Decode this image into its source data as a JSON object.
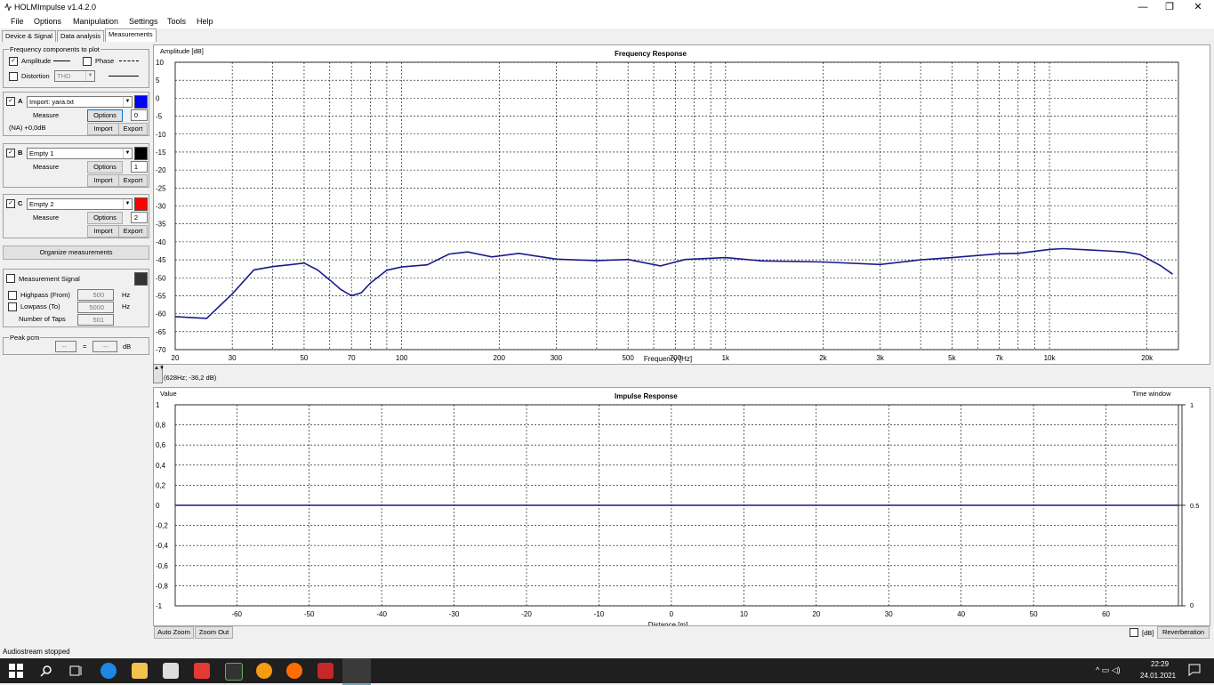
{
  "window": {
    "title": "HOLMImpulse  v1.4.2.0",
    "minimize": "—",
    "maximize": "❐",
    "close": "✕"
  },
  "menu": [
    "File",
    "Options",
    "Manipulation",
    "Settings",
    "Tools",
    "Help"
  ],
  "tabs": [
    "Device & Signal",
    "Data analysis",
    "Measurements"
  ],
  "freq_components": {
    "legend": "Frequency components to plot",
    "amplitude": {
      "label": "Amplitude",
      "checked": true
    },
    "phase": {
      "label": "Phase",
      "checked": false
    },
    "distortion": {
      "label": "Distortion",
      "checked": false,
      "value": "THD"
    }
  },
  "channels": [
    {
      "letter": "A",
      "checked": true,
      "name": "Import: yara.txt",
      "color": "#0000ff",
      "measure": "Measure",
      "options": "Options",
      "num": "0",
      "info": "(NA) +0,0dB",
      "import": "Import",
      "export": "Export"
    },
    {
      "letter": "B",
      "checked": true,
      "name": "Empty 1",
      "color": "#000000",
      "measure": "Measure",
      "options": "Options",
      "num": "1",
      "info": "",
      "import": "Import",
      "export": "Export"
    },
    {
      "letter": "C",
      "checked": true,
      "name": "Empty 2",
      "color": "#ff0000",
      "measure": "Measure",
      "options": "Options",
      "num": "2",
      "info": "",
      "import": "Import",
      "export": "Export"
    }
  ],
  "organize": "Organize measurements",
  "signal": {
    "measurement_signal": "Measurement Signal",
    "highpass": "Highpass (From)",
    "highpass_val": "500",
    "hz1": "Hz",
    "lowpass": "Lowpass (To)",
    "lowpass_val": "5000",
    "hz2": "Hz",
    "taps": "Number of Taps",
    "taps_val": "501"
  },
  "peak": {
    "legend": "Peak pcm",
    "v1": "--",
    "eq": "=",
    "v2": "--",
    "unit": "dB"
  },
  "freq_chart": {
    "title": "Frequency Response",
    "ylabel": "Amplitude [dB]",
    "xlabel": "Frequency [Hz]",
    "cursor": "(628Hz; -36,2 dB)",
    "scroll_icon": "▲▼"
  },
  "imp_chart": {
    "title": "Impulse Response",
    "ylabel": "Value",
    "xlabel": "Distance [m]",
    "time_window": "Time window",
    "tw_top": "1",
    "tw_mid": "0.5",
    "tw_bot": "0",
    "auto_zoom": "Auto Zoom",
    "zoom_out": "Zoom Out",
    "db_label": "[dB]",
    "reverberation": "Reverberation"
  },
  "status": "Audiostream stopped",
  "taskbar": {
    "time": "22:29",
    "date": "24.01.2021",
    "tray": "^ ▭ ◁)"
  },
  "chart_data": [
    {
      "type": "line",
      "title": "Frequency Response",
      "xlabel": "Frequency [Hz]",
      "ylabel": "Amplitude [dB]",
      "xscale": "log",
      "xlim": [
        20,
        25000
      ],
      "ylim": [
        -70,
        10
      ],
      "yticks": [
        10,
        5,
        0,
        -5,
        -10,
        -15,
        -20,
        -25,
        -30,
        -35,
        -40,
        -45,
        -50,
        -55,
        -60,
        -65,
        -70
      ],
      "xticks": [
        20,
        30,
        50,
        70,
        100,
        200,
        300,
        500,
        700,
        1000,
        2000,
        3000,
        5000,
        7000,
        10000,
        20000
      ],
      "xticklabels": [
        "20",
        "30",
        "50",
        "70",
        "100",
        "200",
        "300",
        "500",
        "700",
        "1k",
        "2k",
        "3k",
        "5k",
        "7k",
        "10k",
        "20k"
      ],
      "grid": true,
      "series": [
        {
          "color": "#1a1a8c",
          "x": [
            20,
            25,
            30,
            35,
            40,
            45,
            50,
            55,
            60,
            65,
            70,
            75,
            80,
            90,
            100,
            120,
            140,
            160,
            190,
            230,
            300,
            400,
            500,
            630,
            750,
            1000,
            1300,
            2000,
            3000,
            4000,
            5000,
            6000,
            7000,
            8000,
            9000,
            10000,
            11000,
            13000,
            15000,
            17000,
            19000,
            22000,
            24000
          ],
          "y": [
            -60.8,
            -61.3,
            -54.5,
            -47.8,
            -46.9,
            -46.4,
            -45.9,
            -47.8,
            -50.6,
            -53.3,
            -55.0,
            -54.2,
            -51.5,
            -47.9,
            -47.0,
            -46.4,
            -43.4,
            -42.8,
            -44.2,
            -43.2,
            -44.8,
            -45.2,
            -44.9,
            -46.7,
            -44.9,
            -44.4,
            -45.3,
            -45.6,
            -46.3,
            -45.0,
            -44.4,
            -43.8,
            -43.3,
            -43.2,
            -42.6,
            -42.1,
            -41.9,
            -42.2,
            -42.5,
            -42.8,
            -43.5,
            -46.6,
            -49.0
          ]
        }
      ]
    },
    {
      "type": "line",
      "title": "Impulse Response",
      "xlabel": "Distance [m]",
      "ylabel": "Value",
      "xlim": [
        -68.5,
        70
      ],
      "ylim": [
        -1,
        1
      ],
      "xticks": [
        -60,
        -50,
        -40,
        -30,
        -20,
        -10,
        0,
        10,
        20,
        30,
        40,
        50,
        60
      ],
      "yticks": [
        1,
        0.8,
        0.6,
        0.4,
        0.2,
        0,
        -0.2,
        -0.4,
        -0.6,
        -0.8,
        -1
      ],
      "yticklabels": [
        "1",
        "0,8",
        "0,6",
        "0,4",
        "0,2",
        "0",
        "-0,2",
        "-0,4",
        "-0,6",
        "-0,8",
        "-1"
      ],
      "grid": true,
      "series": [
        {
          "color": "#1a1a8c",
          "x": [
            -68.5,
            70
          ],
          "y": [
            0,
            0
          ]
        }
      ]
    }
  ]
}
